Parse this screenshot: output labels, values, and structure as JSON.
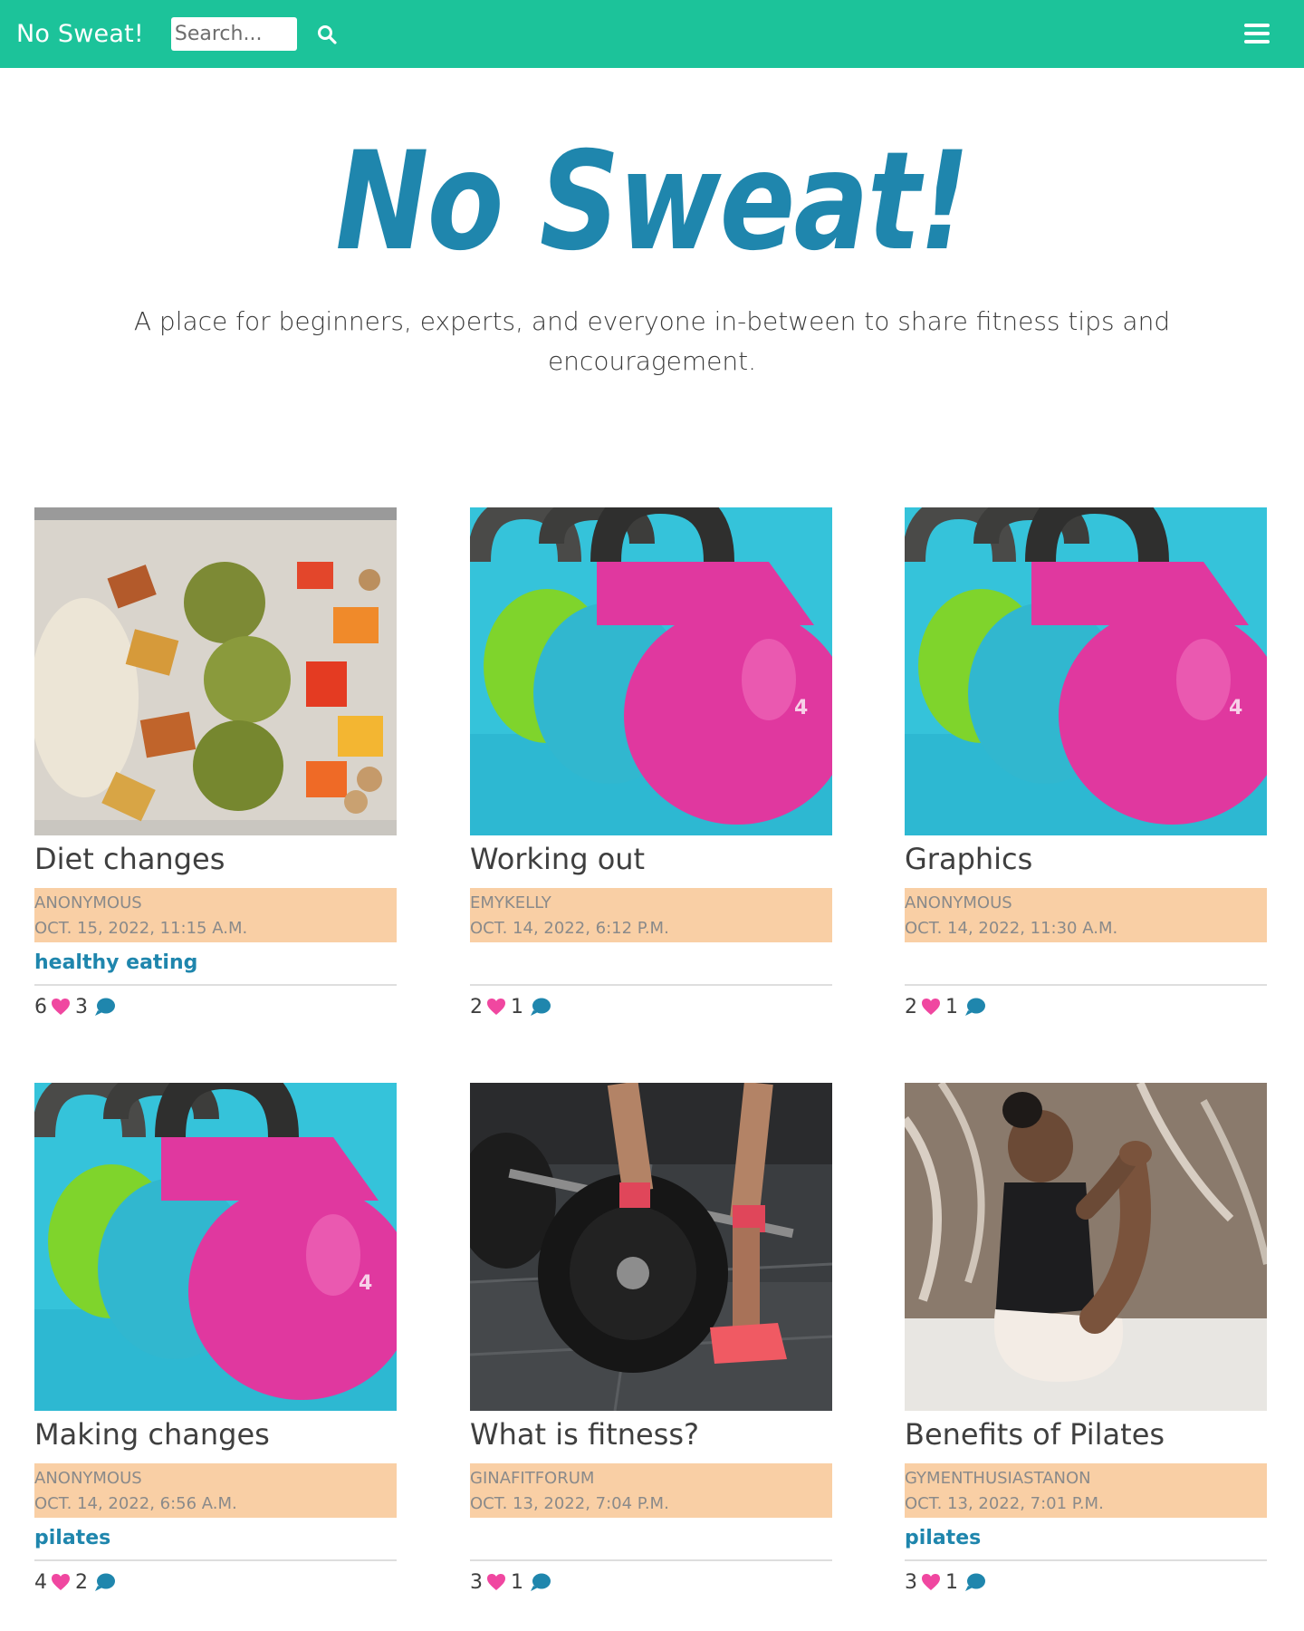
{
  "nav": {
    "brand": "No Sweat!",
    "search_placeholder": "Search..."
  },
  "hero": {
    "title": "No Sweat!",
    "subtitle": "A place for beginners, experts, and everyone in-between to share fitness tips and encouragement."
  },
  "colors": {
    "navbar": "#1cc39a",
    "accent_blue": "#1f86ad",
    "meta_background": "#f9cfa5",
    "like_pink": "#f047a0",
    "comment_blue": "#1f86ad"
  },
  "posts": [
    {
      "title": "Diet changes",
      "author": "ANONYMOUS",
      "date": "OCT. 15, 2022, 11:15 A.M.",
      "tag": "healthy eating",
      "likes": "6",
      "comments": "3",
      "image": "food-bowl-image"
    },
    {
      "title": "Working out",
      "author": "EMYKELLY",
      "date": "OCT. 14, 2022, 6:12 P.M.",
      "tag": "",
      "likes": "2",
      "comments": "1",
      "image": "kettlebells-image"
    },
    {
      "title": "Graphics",
      "author": "ANONYMOUS",
      "date": "OCT. 14, 2022, 11:30 A.M.",
      "tag": "",
      "likes": "2",
      "comments": "1",
      "image": "kettlebells-image"
    },
    {
      "title": "Making changes",
      "author": "ANONYMOUS",
      "date": "OCT. 14, 2022, 6:56 A.M.",
      "tag": "pilates",
      "likes": "4",
      "comments": "2",
      "image": "kettlebells-image"
    },
    {
      "title": "What is fitness?",
      "author": "GINAFITFORUM",
      "date": "OCT. 13, 2022, 7:04 P.M.",
      "tag": "",
      "likes": "3",
      "comments": "1",
      "image": "barbell-image"
    },
    {
      "title": "Benefits of Pilates",
      "author": "GYMENTHUSIASTANON",
      "date": "OCT. 13, 2022, 7:01 P.M.",
      "tag": "pilates",
      "likes": "3",
      "comments": "1",
      "image": "pilates-image"
    }
  ]
}
